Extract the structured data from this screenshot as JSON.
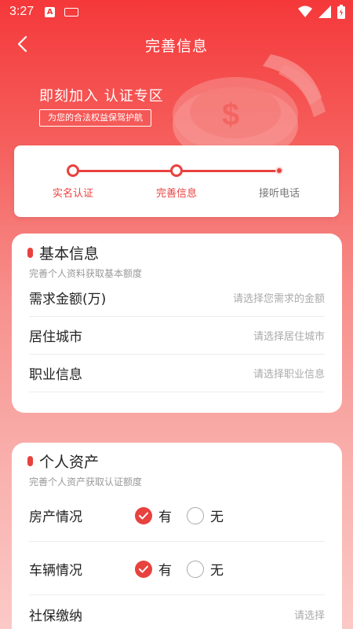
{
  "status_bar": {
    "time": "3:27",
    "a_icon": "A"
  },
  "header": {
    "title": "完善信息"
  },
  "banner": {
    "headline": "即刻加入 认证专区",
    "tag": "为您的合法权益保驾护航"
  },
  "steps": [
    {
      "label": "实名认证",
      "state": "done"
    },
    {
      "label": "完善信息",
      "state": "current"
    },
    {
      "label": "接听电话",
      "state": "pending"
    }
  ],
  "basic": {
    "title": "基本信息",
    "subtitle": "完善个人资料获取基本额度",
    "rows": [
      {
        "label": "需求金额(万)",
        "placeholder": "请选择您需求的金额"
      },
      {
        "label": "居住城市",
        "placeholder": "请选择居住城市"
      },
      {
        "label": "职业信息",
        "placeholder": "请选择职业信息"
      }
    ]
  },
  "assets": {
    "title": "个人资产",
    "subtitle": "完善个人资产获取认证额度",
    "radio_rows": [
      {
        "label": "房产情况",
        "yes": "有",
        "no": "无",
        "selected": "有"
      },
      {
        "label": "车辆情况",
        "yes": "有",
        "no": "无",
        "selected": "有"
      }
    ],
    "select_row": {
      "label": "社保缴纳",
      "placeholder": "请选择"
    }
  },
  "colors": {
    "accent": "#e8423f",
    "header_red": "#f5383a"
  },
  "icons": [
    "back-arrow-icon",
    "wifi-icon",
    "signal-icon",
    "battery-icon",
    "coin-icon",
    "check-icon"
  ]
}
